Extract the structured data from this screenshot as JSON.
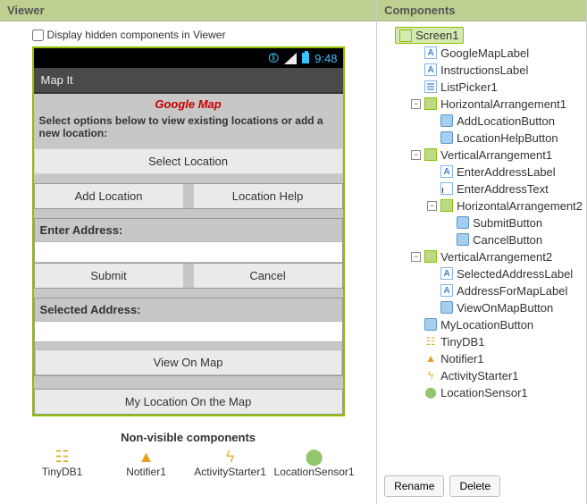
{
  "viewer": {
    "title": "Viewer",
    "display_hidden_label": "Display hidden components in Viewer",
    "status_time": "9:48",
    "app_title": "Map It",
    "google_map_label": "Google Map",
    "instructions": "Select options below to view existing locations or add a new location:",
    "listpicker": "Select Location",
    "add_location_btn": "Add Location",
    "location_help_btn": "Location Help",
    "enter_address_label": "Enter Address:",
    "submit_btn": "Submit",
    "cancel_btn": "Cancel",
    "selected_address_label": "Selected Address:",
    "view_on_map_btn": "View On Map",
    "my_location_btn": "My Location On the Map",
    "nonvisible_title": "Non-visible components",
    "nonvisible": [
      "TinyDB1",
      "Notifier1",
      "ActivityStarter1",
      "LocationSensor1"
    ]
  },
  "components": {
    "title": "Components",
    "tree": {
      "screen": "Screen1",
      "google_map_label": "GoogleMapLabel",
      "instructions_label": "InstructionsLabel",
      "listpicker": "ListPicker1",
      "h1": "HorizontalArrangement1",
      "add_location": "AddLocationButton",
      "location_help": "LocationHelpButton",
      "v1": "VerticalArrangement1",
      "enter_address_label": "EnterAddressLabel",
      "enter_address_text": "EnterAddressText",
      "h2": "HorizontalArrangement2",
      "submit": "SubmitButton",
      "cancel": "CancelButton",
      "v2": "VerticalArrangement2",
      "selected_address_label": "SelectedAddressLabel",
      "address_for_map_label": "AddressForMapLabel",
      "view_on_map": "ViewOnMapButton",
      "my_location": "MyLocationButton",
      "tinydb": "TinyDB1",
      "notifier": "Notifier1",
      "activity_starter": "ActivityStarter1",
      "location_sensor": "LocationSensor1"
    },
    "rename_btn": "Rename",
    "delete_btn": "Delete"
  }
}
